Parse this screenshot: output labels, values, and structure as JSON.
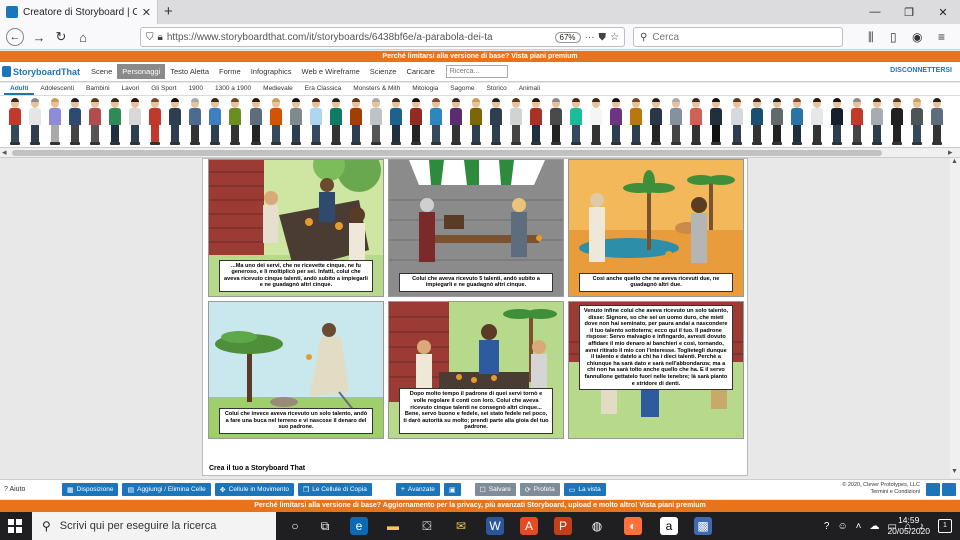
{
  "browser": {
    "tab_title": "Creatore di Storyboard | Cometo",
    "tab_close": "✕",
    "new_tab": "+",
    "url": "https://www.storyboardthat.com/it/storyboards/6438bf6e/a-parabola-dei-ta",
    "zoom": "67%",
    "search_placeholder": "Cerca",
    "window_controls": [
      "—",
      "❐",
      "✕"
    ]
  },
  "site": {
    "promo_top": "Perché limitarsi alla versione di base? Vista piani premium",
    "logo_text": "StoryboardThat",
    "nav_links": [
      "Scene",
      "Personaggi",
      "Testo Aletta",
      "Forme",
      "Infographics",
      "Web e Wireframe",
      "Scienze",
      "Caricare"
    ],
    "active_nav_index": 1,
    "search_placeholder": "Ricerca...",
    "disconnect": "DISCONNETTERSI",
    "categories": [
      "Adulti",
      "Adolescenti",
      "Bambini",
      "Lavori",
      "Gli Sport",
      "1900",
      "1300 a 1900",
      "Medievale",
      "Era Classica",
      "Monsters & Mith",
      "Mitologia",
      "Sagome",
      "Storico",
      "Animali"
    ],
    "active_category_index": 0
  },
  "characters": [
    {
      "hair": "#3a2a1a",
      "top": "#c0392b",
      "legs": "#34495e"
    },
    {
      "hair": "#8a8a8a",
      "top": "#e5e5e5",
      "legs": "#2c3e50"
    },
    {
      "hair": "#c8a060",
      "top": "#8e8cd8",
      "legs": "#aaaaaa"
    },
    {
      "hair": "#222222",
      "top": "#2e4a6e",
      "legs": "#444444"
    },
    {
      "hair": "#5a3a1a",
      "top": "#b14d4d",
      "legs": "#555555"
    },
    {
      "hair": "#3a2a1a",
      "top": "#2e8b57",
      "legs": "#1f2f3f"
    },
    {
      "hair": "#2a1a0a",
      "top": "#d8d8d8",
      "legs": "#2c3e50"
    },
    {
      "hair": "#7a4a2a",
      "top": "#c0392b",
      "legs": "#c0392b"
    },
    {
      "hair": "#111111",
      "top": "#2c3e50",
      "legs": "#2c3e50"
    },
    {
      "hair": "#aaaaaa",
      "top": "#4e6a8e",
      "legs": "#333333"
    },
    {
      "hair": "#3a2a1a",
      "top": "#3f7fbf",
      "legs": "#2c3e50"
    },
    {
      "hair": "#6a4a2a",
      "top": "#6b8e23",
      "legs": "#333333"
    },
    {
      "hair": "#2a1a0a",
      "top": "#5d6d7e",
      "legs": "#222222"
    },
    {
      "hair": "#c8a060",
      "top": "#d35400",
      "legs": "#34495e"
    },
    {
      "hair": "#111111",
      "top": "#7f8c8d",
      "legs": "#2c3e50"
    },
    {
      "hair": "#4a2a1a",
      "top": "#aed6f1",
      "legs": "#34495e"
    },
    {
      "hair": "#222222",
      "top": "#117a65",
      "legs": "#333333"
    },
    {
      "hair": "#5a3a1a",
      "top": "#a04000",
      "legs": "#2c3e50"
    },
    {
      "hair": "#aaaaaa",
      "top": "#bdc3c7",
      "legs": "#555555"
    },
    {
      "hair": "#3a2a1a",
      "top": "#1f618d",
      "legs": "#1f2f3f"
    },
    {
      "hair": "#111111",
      "top": "#922b21",
      "legs": "#222222"
    },
    {
      "hair": "#7a4a2a",
      "top": "#2e86c1",
      "legs": "#34495e"
    },
    {
      "hair": "#3a2a1a",
      "top": "#5b2c6f",
      "legs": "#333333"
    },
    {
      "hair": "#c8a060",
      "top": "#7d6608",
      "legs": "#2c3e50"
    },
    {
      "hair": "#222222",
      "top": "#2c3e50",
      "legs": "#2c3e50"
    },
    {
      "hair": "#5a3a1a",
      "top": "#d0d3d4",
      "legs": "#444444"
    },
    {
      "hair": "#2a1a0a",
      "top": "#a93226",
      "legs": "#1f2f3f"
    },
    {
      "hair": "#8a8a8a",
      "top": "#4a4a4a",
      "legs": "#222222"
    },
    {
      "hair": "#4a2a1a",
      "top": "#1abc9c",
      "legs": "#34495e"
    },
    {
      "hair": "#3a2a1a",
      "top": "#f5f5f5",
      "legs": "#333333"
    },
    {
      "hair": "#111111",
      "top": "#6c3483",
      "legs": "#2c3e50"
    },
    {
      "hair": "#6a4a2a",
      "top": "#b9770e",
      "legs": "#2c3e50"
    },
    {
      "hair": "#222222",
      "top": "#283747",
      "legs": "#222222"
    },
    {
      "hair": "#aaaaaa",
      "top": "#85929e",
      "legs": "#444444"
    },
    {
      "hair": "#3a2a1a",
      "top": "#cd6155",
      "legs": "#333333"
    },
    {
      "hair": "#111111",
      "top": "#212f3c",
      "legs": "#111111"
    },
    {
      "hair": "#5a3a1a",
      "top": "#d5d8dc",
      "legs": "#2c3e50"
    },
    {
      "hair": "#3a2a1a",
      "top": "#1b4f72",
      "legs": "#333333"
    },
    {
      "hair": "#222222",
      "top": "#616a6b",
      "legs": "#222222"
    },
    {
      "hair": "#7a4a2a",
      "top": "#2874a6",
      "legs": "#1f2f3f"
    },
    {
      "hair": "#2a1a0a",
      "top": "#e5e7e9",
      "legs": "#333333"
    },
    {
      "hair": "#111111",
      "top": "#17202a",
      "legs": "#2c3e50"
    },
    {
      "hair": "#8a8a8a",
      "top": "#c0392b",
      "legs": "#444444"
    },
    {
      "hair": "#3a2a1a",
      "top": "#a6acaf",
      "legs": "#2c3e50"
    },
    {
      "hair": "#5a3a1a",
      "top": "#212121",
      "legs": "#222222"
    },
    {
      "hair": "#c8a060",
      "top": "#4d5656",
      "legs": "#34495e"
    },
    {
      "hair": "#222222",
      "top": "#5d6d7e",
      "legs": "#333333"
    }
  ],
  "storyboard": {
    "captions": [
      "...Ma uno dei servi, che ne ricevette cinque, ne fu generoso, e li moltiplicò per sei. Infatti, colui che aveva ricevuto cinque talenti, andò subito a impiegarli e ne guadagnò altri cinque.",
      "Colui che aveva ricevuto 5 talenti, andò subito a impiegarli e ne guadagnò altri cinque.",
      "Così anche quello che ne aveva ricevuti due, ne guadagnò altri due.",
      "Colui che invece aveva ricevuto un solo talento, andò a fare una buca nel terreno e vi nascose il denaro del suo padrone.",
      "Dopo molto tempo il padrone di quei servi tornò e volle regolare il conti con loro. Colui che aveva ricevuto cinque talenti ne consegnò altri cinque... Bene, servo buono e fedele, sei stato fedele nel poco, ti darò autorità su molto; prendi parte alla gioia del tuo padrone.",
      "Venuto infine colui che aveva ricevuto un solo talento, disse: Signore, so che sei un uomo duro, che mieti dove non hai seminato, per paura andai a nascondere il tuo talento sottoterra; ecco qui il tuo. Il padrone rispose: Servo malvagio e infingardo, avresti dovuto affidare il mio denaro ai banchieri e così, tornando, avrei ritirato il mio con l'interesse. Toglietegli dunque il talento e datelo a chi ha i dieci talenti. Perchè a chiunque ha sarà dato e sarà nell'abbondanza; ma a chi non ha sarà tolto anche quello che ha. E il servo fannullone gettatelo fuori nelle tenebre; là sarà pianto e stridore di denti."
    ],
    "footer": "Crea il tuo a Storyboard That"
  },
  "toolbar": {
    "help": "? Aiuto",
    "buttons": [
      {
        "label": "Disposizione",
        "icon": "▦"
      },
      {
        "label": "Aggiungi / Elimina Celle",
        "icon": "▤"
      },
      {
        "label": "Cellule in Movimento",
        "icon": "✥"
      },
      {
        "label": "Le Cellule di Copia",
        "icon": "❐"
      },
      {
        "label": "Avanzate",
        "icon": "+"
      },
      {
        "label": "",
        "icon": "▣"
      },
      {
        "label": "Salvare",
        "icon": "☐"
      },
      {
        "label": "Profeta",
        "icon": "⟳"
      },
      {
        "label": "La vista",
        "icon": "▭"
      }
    ],
    "copyright_line1": "© 2020, Clever Prototypes, LLC",
    "copyright_line2": "Termini e Condizioni",
    "promo_bottom": "Perché limitarsi alla versione di base? Aggiornamento per la privacy, più avanzati Storyboard, upload e molto altro! Vista piani premium"
  },
  "taskbar": {
    "search_text": "Scrivi qui per eseguire la ricerca",
    "time": "14:59",
    "date": "20/05/2020",
    "notifications": "1"
  },
  "colors": {
    "brand_blue": "#1b75bb",
    "promo_orange": "#e8731a",
    "taskbar": "#1f1f22"
  }
}
